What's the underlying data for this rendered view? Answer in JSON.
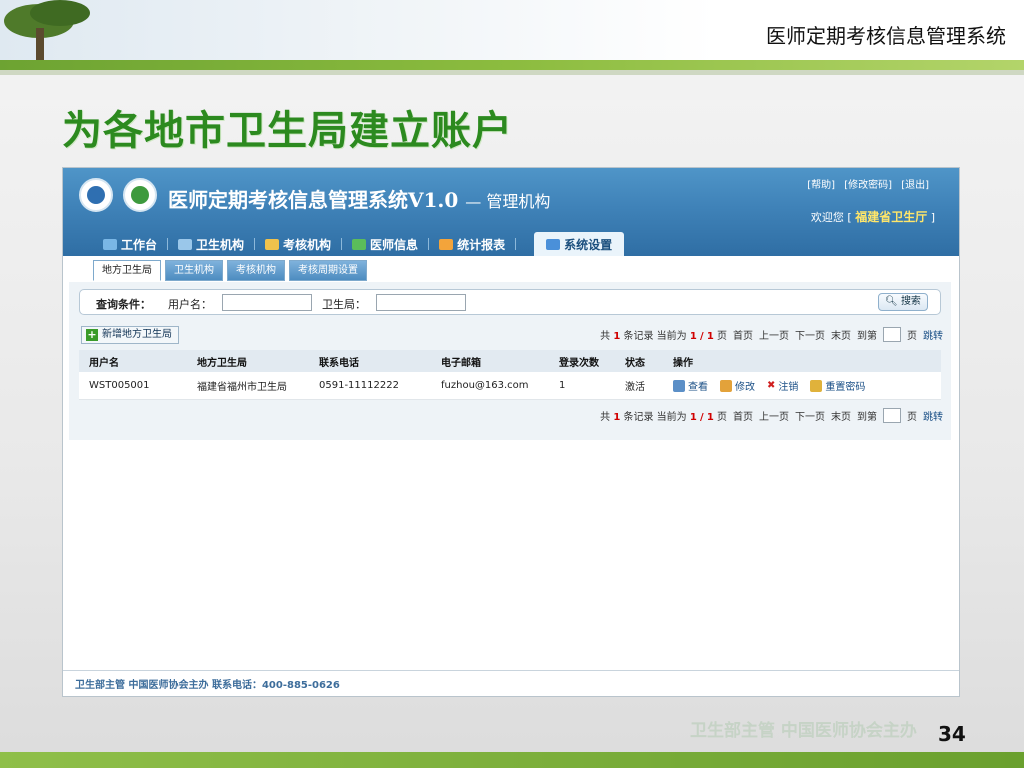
{
  "slide": {
    "top_title": "医师定期考核信息管理系统",
    "heading": "为各地市卫生局建立账户",
    "page_number": "34",
    "watermark": "卫生部主管   中国医师协会主办"
  },
  "app": {
    "title": "医师定期考核信息管理系统V1.0",
    "title_suffix": "— 管理机构",
    "header_links": [
      "[帮助]",
      "[修改密码]",
      "[退出]"
    ],
    "welcome_prefix": "欢迎您 [",
    "welcome_user": "福建省卫生厅",
    "welcome_suffix": "]",
    "nav": [
      {
        "label": "工作台",
        "icon": "desk-icon",
        "color": "#7ab7e6"
      },
      {
        "label": "卫生机构",
        "icon": "hospital-icon",
        "color": "#9ac7ea"
      },
      {
        "label": "考核机构",
        "icon": "exam-icon",
        "color": "#f0c24c"
      },
      {
        "label": "医师信息",
        "icon": "doctor-icon",
        "color": "#5bbd5a"
      },
      {
        "label": "统计报表",
        "icon": "chart-icon",
        "color": "#f3a43b"
      }
    ],
    "nav_active": {
      "label": "系统设置",
      "icon": "settings-icon",
      "color": "#4a90d9"
    },
    "subtabs": [
      "地方卫生局",
      "卫生机构",
      "考核机构",
      "考核周期设置"
    ],
    "query": {
      "label": "查询条件：",
      "username_label": "用户名：",
      "bureau_label": "卫生局：",
      "search_button": "搜索"
    },
    "add_button": "新增地方卫生局",
    "pager": {
      "prefix": "共",
      "total": "1",
      "records_text": "条记录 当前为",
      "current": "1",
      "slash": "/",
      "pages": "1",
      "page_text": "页",
      "first": "首页",
      "prev": "上一页",
      "next": "下一页",
      "last": "末页",
      "goto": "到第",
      "page_unit": "页",
      "jump": "跳转"
    },
    "table": {
      "headers": [
        "用户名",
        "地方卫生局",
        "联系电话",
        "电子邮箱",
        "登录次数",
        "状态",
        "操作"
      ],
      "rows": [
        {
          "username": "WST005001",
          "bureau": "福建省福州市卫生局",
          "phone": "0591-11112222",
          "email": "fuzhou@163.com",
          "logins": "1",
          "status": "激活"
        }
      ],
      "actions": [
        "查看",
        "修改",
        "注销",
        "重置密码"
      ]
    },
    "footer": "卫生部主管   中国医师协会主办   联系电话：400-885-0626"
  }
}
